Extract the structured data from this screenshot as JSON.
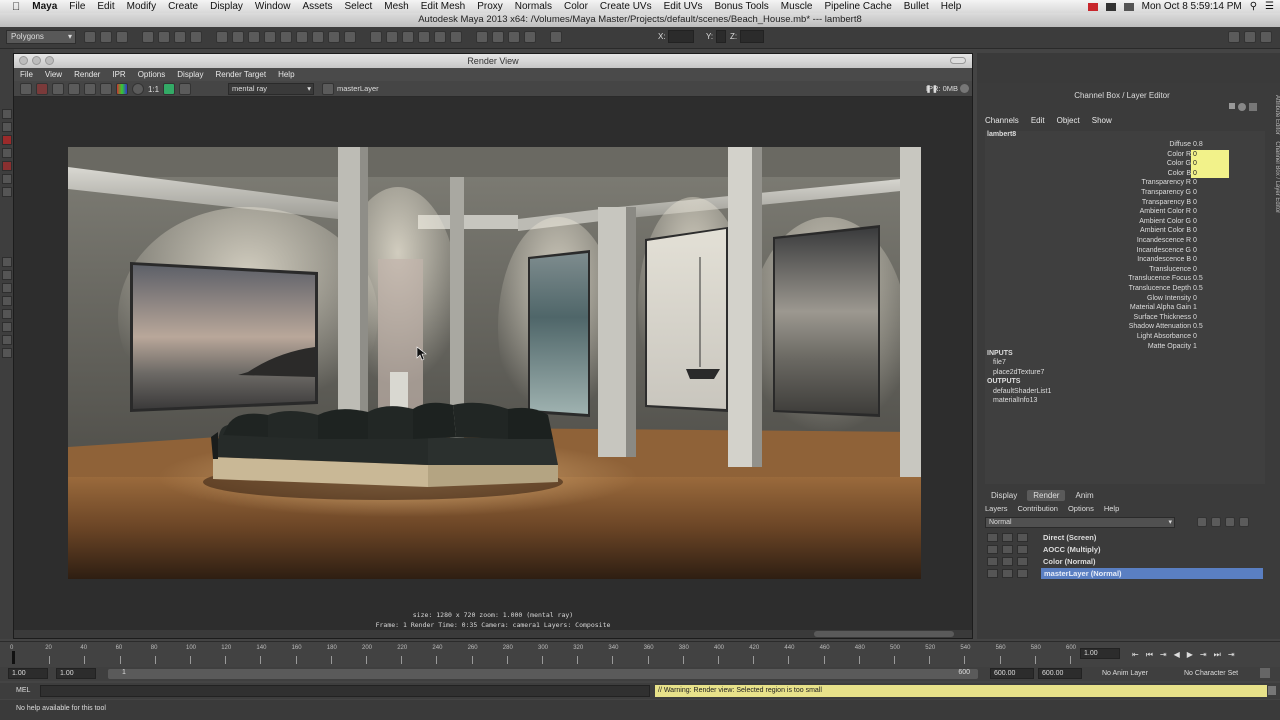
{
  "mac_menubar": {
    "app": "Maya",
    "items": [
      "File",
      "Edit",
      "Modify",
      "Create",
      "Display",
      "Window",
      "Assets",
      "Select",
      "Mesh",
      "Edit Mesh",
      "Proxy",
      "Normals",
      "Color",
      "Create UVs",
      "Edit UVs",
      "Bonus Tools",
      "Muscle",
      "Pipeline Cache",
      "Bullet",
      "Help"
    ],
    "clock": "Mon Oct 8  5:59:14 PM"
  },
  "window_title": "Autodesk Maya 2013 x64: /Volumes/Maya Master/Projects/default/scenes/Beach_House.mb*  ---  lambert8",
  "status_line": {
    "mode": "Polygons",
    "x_label": "X:",
    "y_label": "Y:",
    "z_label": "Z:"
  },
  "render_view": {
    "title": "Render View",
    "menu": [
      "File",
      "View",
      "Render",
      "IPR",
      "Options",
      "Display",
      "Render Target",
      "Help"
    ],
    "renderer": "mental ray",
    "layer": "masterLayer",
    "ratio_label": "1:1",
    "ipr_memory": "IPR: 0MB",
    "info_line1": "size: 1280 x 720  zoom: 1.000     (mental ray)",
    "info_line2": "Frame: 1     Render Time: 0:35     Camera: camera1     Layers: Composite"
  },
  "channel_box": {
    "title": "Channel Box / Layer Editor",
    "menu": [
      "Channels",
      "Edit",
      "Object",
      "Show"
    ],
    "node": "lambert8",
    "attributes": [
      {
        "name": "Diffuse",
        "value": "0.8",
        "highlight": false
      },
      {
        "name": "Color R",
        "value": "0",
        "highlight": true
      },
      {
        "name": "Color G",
        "value": "0",
        "highlight": true
      },
      {
        "name": "Color B",
        "value": "0",
        "highlight": true
      },
      {
        "name": "Transparency R",
        "value": "0",
        "highlight": false
      },
      {
        "name": "Transparency G",
        "value": "0",
        "highlight": false
      },
      {
        "name": "Transparency B",
        "value": "0",
        "highlight": false
      },
      {
        "name": "Ambient Color R",
        "value": "0",
        "highlight": false
      },
      {
        "name": "Ambient Color G",
        "value": "0",
        "highlight": false
      },
      {
        "name": "Ambient Color B",
        "value": "0",
        "highlight": false
      },
      {
        "name": "Incandescence R",
        "value": "0",
        "highlight": false
      },
      {
        "name": "Incandescence G",
        "value": "0",
        "highlight": false
      },
      {
        "name": "Incandescence B",
        "value": "0",
        "highlight": false
      },
      {
        "name": "Translucence",
        "value": "0",
        "highlight": false
      },
      {
        "name": "Translucence Focus",
        "value": "0.5",
        "highlight": false
      },
      {
        "name": "Translucence Depth",
        "value": "0.5",
        "highlight": false
      },
      {
        "name": "Glow Intensity",
        "value": "0",
        "highlight": false
      },
      {
        "name": "Material Alpha Gain",
        "value": "1",
        "highlight": false
      },
      {
        "name": "Surface Thickness",
        "value": "0",
        "highlight": false
      },
      {
        "name": "Shadow Attenuation",
        "value": "0.5",
        "highlight": false
      },
      {
        "name": "Light Absorbance",
        "value": "0",
        "highlight": false
      },
      {
        "name": "Matte Opacity",
        "value": "1",
        "highlight": false
      }
    ],
    "inputs_label": "INPUTS",
    "inputs": [
      "file7",
      "place2dTexture7"
    ],
    "outputs_label": "OUTPUTS",
    "outputs": [
      "defaultShaderList1",
      "materialInfo13"
    ],
    "side_tabs": [
      "Attribute Editor",
      "Channel Box / Layer Editor"
    ]
  },
  "layer_editor": {
    "tabs": [
      "Display",
      "Render",
      "Anim"
    ],
    "active_tab": "Render",
    "menu": [
      "Layers",
      "Contribution",
      "Options",
      "Help"
    ],
    "blend_mode": "Normal",
    "layers": [
      {
        "name": "Direct (Screen)",
        "selected": false
      },
      {
        "name": "AOCC (Multiply)",
        "selected": false
      },
      {
        "name": "Color (Normal)",
        "selected": false
      },
      {
        "name": "masterLayer (Normal)",
        "selected": true
      }
    ]
  },
  "timeline": {
    "ticks": [
      "0",
      "20",
      "40",
      "60",
      "80",
      "100",
      "120",
      "140",
      "160",
      "180",
      "200",
      "220",
      "240",
      "260",
      "280",
      "300",
      "320",
      "340",
      "360",
      "380",
      "400",
      "420",
      "440",
      "460",
      "480",
      "500",
      "520",
      "540",
      "560",
      "580",
      "600"
    ],
    "current_frame": "1.00"
  },
  "range_slider": {
    "start_time": "1.00",
    "playback_start": "1.00",
    "range_start_label": "1",
    "range_end_label": "600",
    "playback_end": "600.00",
    "end_time": "600.00",
    "anim_layer": "No Anim Layer",
    "character_set": "No Character Set"
  },
  "command_line": {
    "label": "MEL",
    "warning": "// Warning: Render view: Selected region is too small"
  },
  "help_line": "No help available for this tool",
  "colors": {
    "highlight_yellow": "#f2f28a",
    "selected_layer": "#5a7fc2",
    "warning_bg": "#e8e28a",
    "mac_close": "#c8262c"
  }
}
